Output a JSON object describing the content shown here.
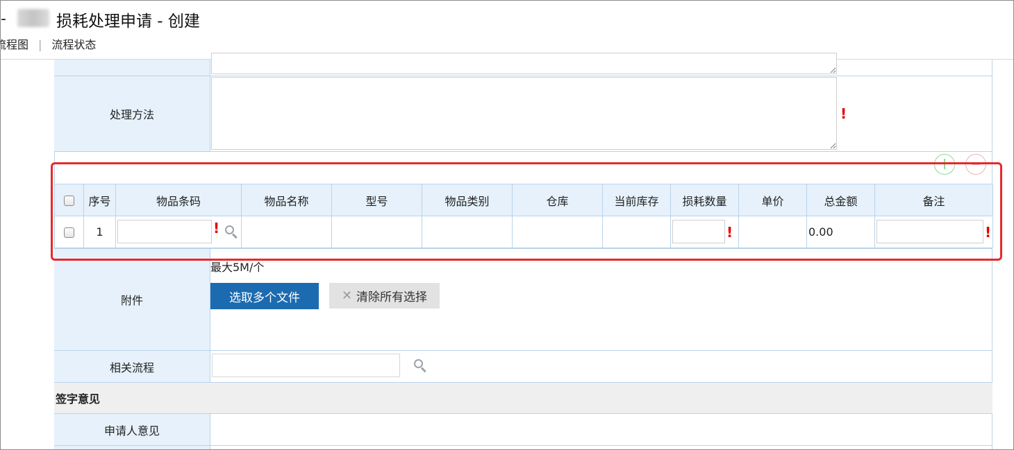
{
  "header": {
    "title": "损耗处理申请 - 创建",
    "nav": [
      "流程图",
      "流程状态"
    ]
  },
  "form": {
    "method_label": "处理方法",
    "attachment_label": "附件",
    "attachment_hint": "最大5M/个",
    "select_files_button": "选取多个文件",
    "clear_selection_button": "清除所有选择",
    "related_process_label": "相关流程",
    "signature_section": "签字意见",
    "applicant_opinion_label": "申请人意见"
  },
  "detail_table": {
    "columns": [
      "序号",
      "物品条码",
      "物品名称",
      "型号",
      "物品类别",
      "仓库",
      "当前库存",
      "损耗数量",
      "单价",
      "总金额",
      "备注"
    ],
    "rows": [
      {
        "index": "1",
        "barcode": "",
        "name": "",
        "model": "",
        "category": "",
        "warehouse": "",
        "stock": "",
        "loss_qty": "",
        "unit_price": "",
        "total": "0.00",
        "remark": ""
      }
    ]
  },
  "colors": {
    "label_bg": "#e6f1fb",
    "border": "#b9d3ea",
    "primary_button": "#1c6bb0",
    "required_mark": "#e60000",
    "highlight": "#e8282a"
  },
  "icons": {
    "required": "!",
    "clear": "✕"
  }
}
